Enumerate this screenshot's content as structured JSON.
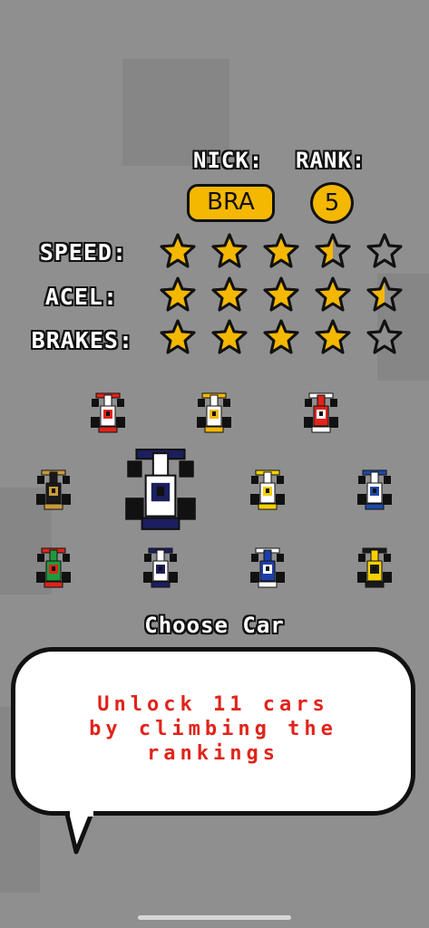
{
  "header": {
    "nick_label": "NICK:",
    "rank_label": "RANK:"
  },
  "player": {
    "nick": "BRA",
    "rank": "5"
  },
  "stats": [
    {
      "label": "SPEED:",
      "rating": 3.5
    },
    {
      "label": "ACEL:",
      "rating": 4.5
    },
    {
      "label": "BRAKES:",
      "rating": 4
    }
  ],
  "max_stars": 5,
  "colors": {
    "star": "#f5b800",
    "pill": "#f5b800",
    "message": "#e0241b"
  },
  "cars": [
    {
      "name": "car-red-white",
      "body": "#ffffff",
      "accent": "#e0241b",
      "selected": false
    },
    {
      "name": "car-white-yellow-blue",
      "body": "#ffffff",
      "accent": "#f5b800",
      "selected": false
    },
    {
      "name": "car-red",
      "body": "#e0241b",
      "accent": "#ffffff",
      "selected": false
    },
    {
      "name": "car-black-gold",
      "body": "#1a1a1a",
      "accent": "#c89b3c",
      "selected": false
    },
    {
      "name": "car-white-navy",
      "body": "#ffffff",
      "accent": "#1c1f5e",
      "selected": true
    },
    {
      "name": "car-yellow-white",
      "body": "#ffffff",
      "accent": "#f5d000",
      "selected": false
    },
    {
      "name": "car-blue-white",
      "body": "#ffffff",
      "accent": "#1e4aa8",
      "selected": false
    },
    {
      "name": "car-green",
      "body": "#1f9a3c",
      "accent": "#e0241b",
      "selected": false
    },
    {
      "name": "car-white-navy-small",
      "body": "#ffffff",
      "accent": "#1c1f5e",
      "selected": false
    },
    {
      "name": "car-blue",
      "body": "#1e3fa8",
      "accent": "#ffffff",
      "selected": false
    },
    {
      "name": "car-yellow-black",
      "body": "#f5d000",
      "accent": "#1a1a1a",
      "selected": false
    }
  ],
  "choose_label": "Choose Car",
  "message": {
    "lines": [
      "Unlock 11 cars",
      "by climbing the",
      "rankings"
    ]
  }
}
